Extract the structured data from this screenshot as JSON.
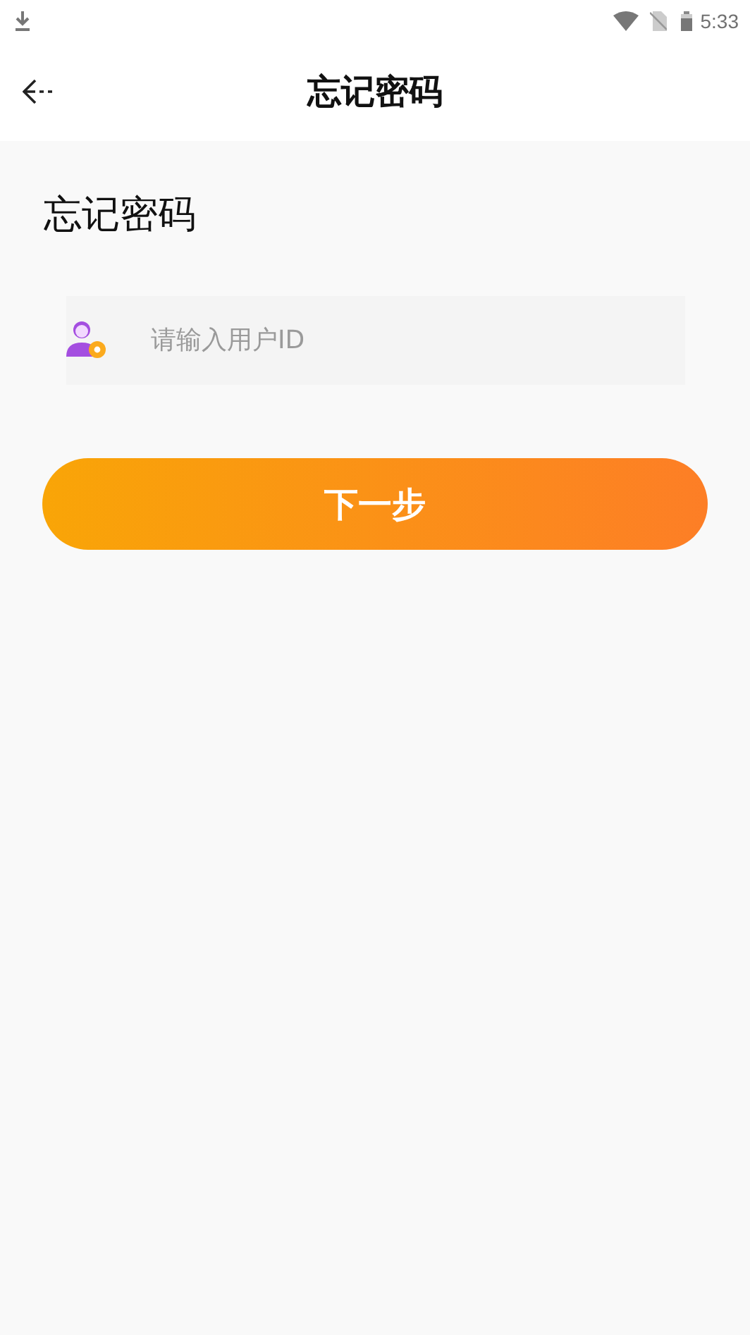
{
  "status_bar": {
    "time": "5:33"
  },
  "header": {
    "title": "忘记密码"
  },
  "page_heading": "忘记密码",
  "user_id_field": {
    "placeholder": "请输入用户ID"
  },
  "next_button": {
    "label": "下一步"
  }
}
